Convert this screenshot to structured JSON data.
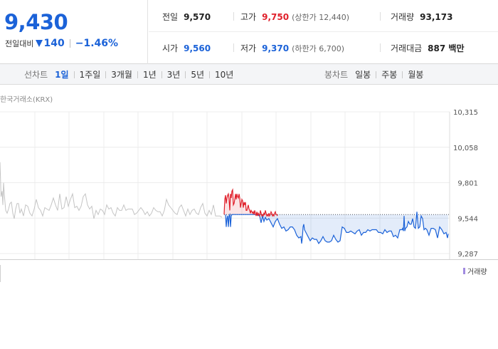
{
  "quote": {
    "price": "9,430",
    "change_label": "전일대비",
    "change": "140",
    "change_rate": "−1.46%"
  },
  "stats": {
    "prev_close_label": "전일",
    "prev_close": "9,570",
    "high_label": "고가",
    "high": "9,750",
    "upper_limit": "(상한가 12,440)",
    "volume_label": "거래량",
    "volume": "93,173",
    "open_label": "시가",
    "open": "9,560",
    "low_label": "저가",
    "low": "9,370",
    "lower_limit": "(하한가 6,700)",
    "value_label": "거래대금",
    "value": "887 백만"
  },
  "periods": {
    "title": "선차트",
    "items": [
      "1일",
      "1주일",
      "3개월",
      "1년",
      "3년",
      "5년",
      "10년"
    ],
    "active_index": 0
  },
  "candles": {
    "title": "봉차트",
    "items": [
      "일봉",
      "주봉",
      "월봉"
    ]
  },
  "chart": {
    "source": "한국거래소(KRX)",
    "volume_legend": "거래량"
  },
  "colors": {
    "down": "#1b62d8",
    "up": "#e0202b",
    "prev_day_line": "#c4c4c4",
    "volume": "#a18be0"
  },
  "chart_data": {
    "type": "line",
    "title": "",
    "xlabel": "",
    "ylabel": "",
    "yticks": [
      10315,
      10058,
      9801,
      9544,
      9287
    ],
    "ylim": [
      9287,
      10315
    ],
    "reference_price": 9570,
    "grid": true,
    "series": [
      {
        "name": "",
        "color": "#c4c4c4",
        "x": [
          0,
          1.5,
          3,
          4,
          5,
          6,
          8,
          10,
          12,
          14,
          16,
          18,
          20,
          22,
          24,
          26,
          28,
          30,
          33,
          36,
          39,
          42,
          45,
          48,
          51,
          54,
          57,
          60,
          63,
          66,
          69,
          72,
          75,
          78,
          81,
          84,
          87,
          90,
          93,
          96,
          99,
          102,
          105,
          108,
          111,
          114,
          117,
          120,
          123,
          126,
          129,
          132,
          135,
          138,
          141,
          144,
          147,
          150,
          153,
          156,
          159,
          162,
          165,
          168,
          171,
          174,
          177,
          180,
          183,
          186,
          189,
          192,
          195,
          198,
          201,
          204,
          207,
          210,
          213,
          216,
          219,
          222,
          225,
          228,
          231,
          234,
          237,
          240,
          243,
          246,
          249,
          252,
          255,
          258,
          261,
          264,
          267,
          270,
          273,
          276,
          279,
          282,
          285,
          288,
          291,
          294,
          297,
          300,
          303,
          306,
          309,
          312
        ],
        "values": [
          9950,
          9700,
          9740,
          9640,
          9800,
          9720,
          9600,
          9580,
          9610,
          9650,
          9660,
          9580,
          9540,
          9610,
          9650,
          9650,
          9580,
          9610,
          9560,
          9640,
          9630,
          9580,
          9560,
          9610,
          9680,
          9620,
          9600,
          9560,
          9620,
          9610,
          9600,
          9640,
          9690,
          9640,
          9600,
          9720,
          9610,
          9620,
          9700,
          9630,
          9680,
          9720,
          9620,
          9630,
          9600,
          9630,
          9700,
          9720,
          9640,
          9610,
          9630,
          9540,
          9600,
          9570,
          9610,
          9600,
          9570,
          9640,
          9610,
          9620,
          9580,
          9560,
          9620,
          9600,
          9600,
          9640,
          9600,
          9610,
          9610,
          9610,
          9570,
          9580,
          9600,
          9620,
          9600,
          9570,
          9590,
          9560,
          9580,
          9620,
          9600,
          9590,
          9590,
          9560,
          9600,
          9680,
          9640,
          9620,
          9600,
          9580,
          9570,
          9620,
          9640,
          9600,
          9560,
          9610,
          9570,
          9600,
          9610,
          9580,
          9570,
          9620,
          9650,
          9580,
          9560,
          9600,
          9570,
          9640,
          9560,
          9560,
          9560,
          9550
        ]
      },
      {
        "name": "",
        "color": "#e0202b",
        "x": [
          315,
          316,
          317,
          318,
          319,
          320,
          321,
          322,
          323,
          324,
          325,
          326,
          327,
          328,
          329,
          330,
          331,
          332,
          333,
          334,
          335,
          336,
          337,
          338,
          339,
          340,
          341,
          342,
          343,
          344,
          345,
          346,
          347,
          348,
          349,
          350,
          351,
          352,
          353,
          354,
          355,
          356,
          357,
          358,
          359,
          360,
          361,
          362,
          363,
          364,
          365,
          366,
          367,
          368,
          369,
          370,
          371,
          372,
          373,
          374,
          375,
          376,
          377,
          378,
          379,
          380,
          381,
          382,
          383,
          384,
          385,
          386,
          387,
          388,
          389,
          390
        ],
        "values": [
          9570,
          9680,
          9710,
          9650,
          9690,
          9710,
          9720,
          9680,
          9600,
          9720,
          9690,
          9740,
          9750,
          9640,
          9650,
          9680,
          9720,
          9680,
          9720,
          9700,
          9690,
          9720,
          9690,
          9620,
          9650,
          9680,
          9670,
          9620,
          9660,
          9640,
          9660,
          9600,
          9600,
          9620,
          9640,
          9610,
          9600,
          9580,
          9600,
          9590,
          9580,
          9590,
          9570,
          9600,
          9580,
          9560,
          9590,
          9560,
          9580,
          9570,
          9560,
          9600,
          9580,
          9560,
          9570,
          9560,
          9580,
          9570,
          9600,
          9580,
          9560,
          9570,
          9560,
          9580,
          9560,
          9570,
          9590,
          9580,
          9560,
          9570,
          9560,
          9580,
          9590,
          9570,
          9570,
          9560
        ]
      },
      {
        "name": "",
        "color": "#1b62d8",
        "x": [
          317,
          318,
          319,
          320,
          321,
          322,
          323,
          324,
          325,
          326,
          327,
          330,
          335,
          340,
          345,
          350,
          355,
          360,
          365,
          367,
          369,
          371,
          373,
          375,
          378,
          381,
          384,
          387,
          390,
          393,
          396,
          399,
          402,
          405,
          408,
          411,
          414,
          417,
          420,
          423,
          424,
          425,
          426,
          427,
          428,
          430,
          433,
          436,
          439,
          442,
          445,
          448,
          451,
          454,
          457,
          460,
          463,
          466,
          469,
          472,
          475,
          478,
          481,
          484,
          487,
          490,
          493,
          496,
          499,
          502,
          505,
          508,
          511,
          514,
          517,
          520,
          523,
          526,
          529,
          532,
          535,
          538,
          541,
          544,
          547,
          550,
          553,
          556,
          559,
          562,
          565,
          566,
          567,
          568,
          569,
          570,
          572,
          574,
          576,
          578,
          580,
          582,
          584,
          586,
          588,
          590,
          592,
          594,
          596,
          598,
          600,
          603,
          606,
          609,
          612,
          615,
          618,
          621,
          624,
          627,
          629,
          630
        ],
        "values": [
          9570,
          9480,
          9540,
          9560,
          9480,
          9560,
          9570,
          9480,
          9560,
          9570,
          9570,
          9570,
          9570,
          9570,
          9570,
          9570,
          9570,
          9570,
          9560,
          9510,
          9560,
          9520,
          9550,
          9530,
          9540,
          9510,
          9480,
          9520,
          9540,
          9500,
          9470,
          9480,
          9450,
          9460,
          9480,
          9480,
          9460,
          9420,
          9400,
          9410,
          9360,
          9400,
          9480,
          9500,
          9460,
          9440,
          9410,
          9380,
          9400,
          9390,
          9390,
          9360,
          9380,
          9410,
          9380,
          9370,
          9370,
          9380,
          9420,
          9390,
          9370,
          9380,
          9480,
          9470,
          9440,
          9440,
          9450,
          9440,
          9430,
          9450,
          9460,
          9420,
          9440,
          9440,
          9460,
          9450,
          9460,
          9460,
          9460,
          9440,
          9440,
          9430,
          9460,
          9440,
          9450,
          9450,
          9410,
          9420,
          9400,
          9460,
          9460,
          9470,
          9450,
          9560,
          9450,
          9470,
          9480,
          9520,
          9500,
          9500,
          9540,
          9480,
          9470,
          9590,
          9470,
          9480,
          9560,
          9540,
          9460,
          9470,
          9460,
          9420,
          9470,
          9470,
          9460,
          9400,
          9480,
          9460,
          9430,
          9440,
          9400,
          9430
        ]
      }
    ]
  }
}
